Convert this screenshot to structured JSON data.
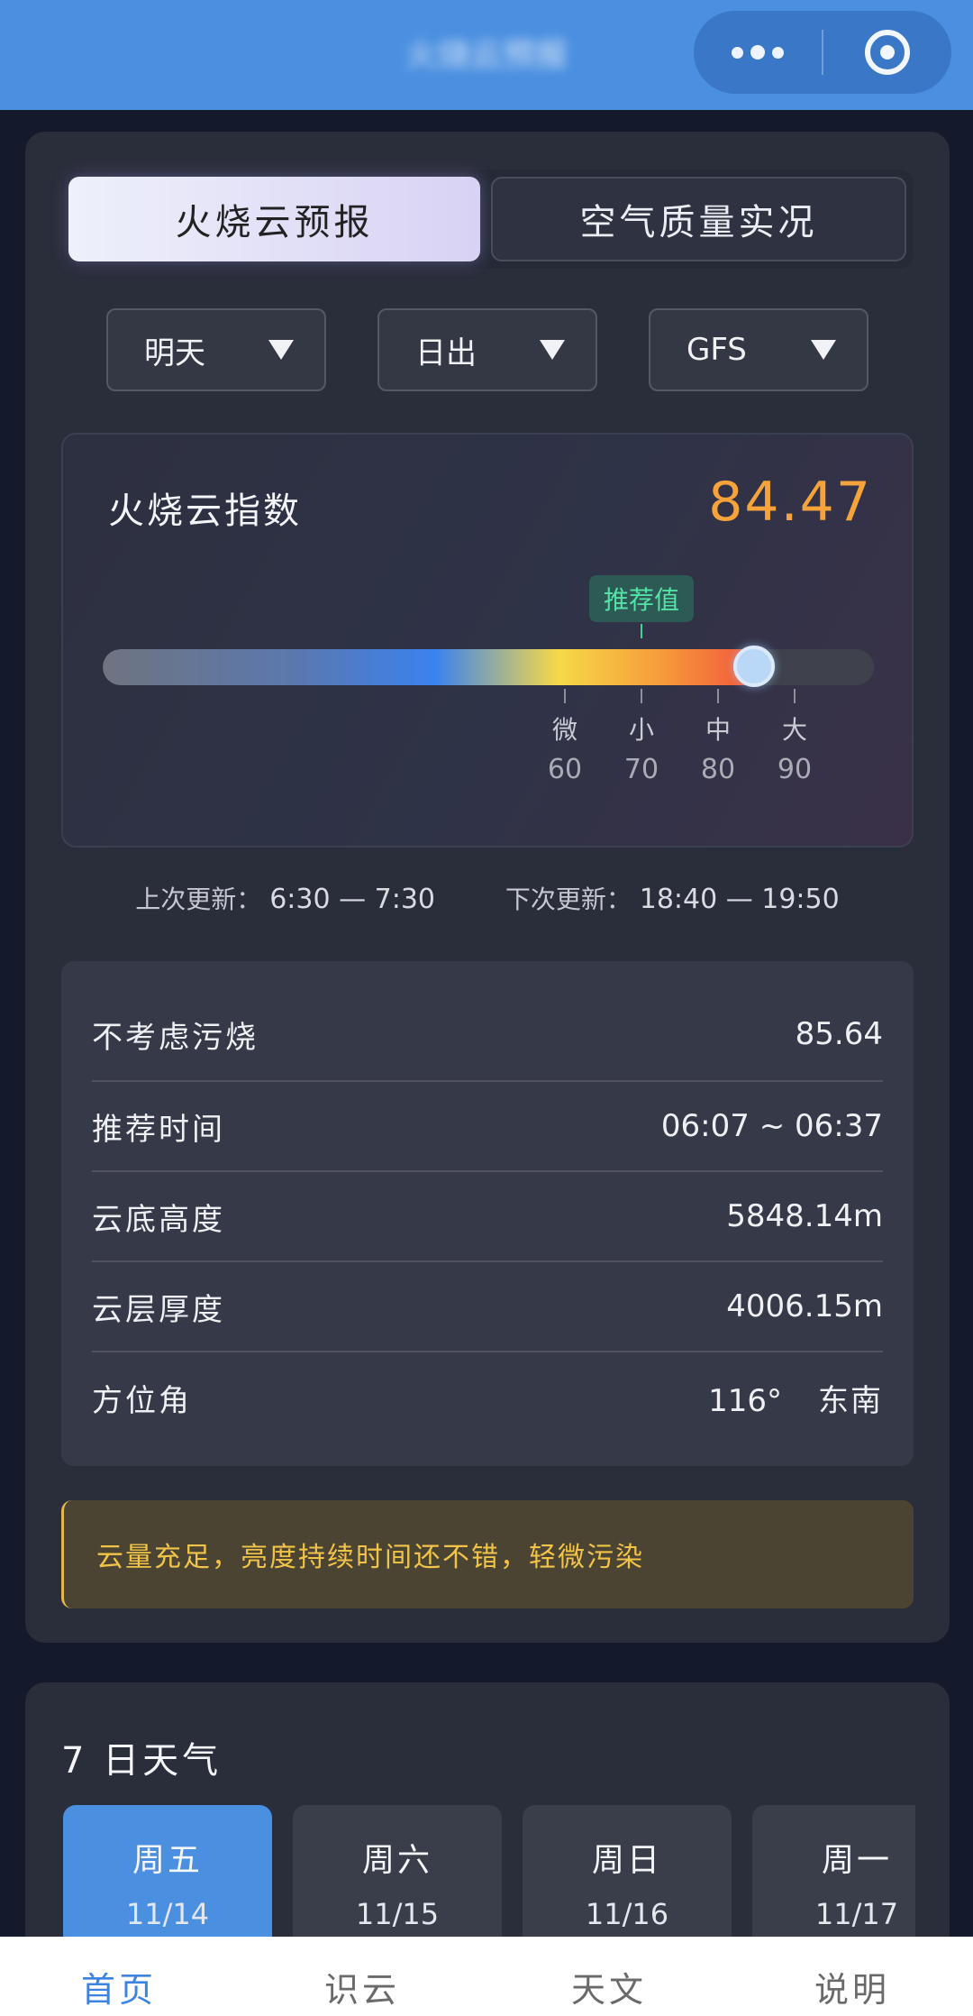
{
  "header": {
    "title": "火烧云预报"
  },
  "tabs": [
    {
      "label": "火烧云预报",
      "active": true
    },
    {
      "label": "空气质量实况",
      "active": false
    }
  ],
  "selects": {
    "day": "明天",
    "event": "日出",
    "model": "GFS"
  },
  "index": {
    "label": "火烧云指数",
    "value": "84.47",
    "progress": 84.47,
    "recommend_label": "推荐值",
    "ticks": [
      {
        "name": "微",
        "value": "60"
      },
      {
        "name": "小",
        "value": "70"
      },
      {
        "name": "中",
        "value": "80"
      },
      {
        "name": "大",
        "value": "90"
      }
    ]
  },
  "update": {
    "last_label": "上次更新：",
    "last_time": "6:30 — 7:30",
    "next_label": "下次更新：",
    "next_time": "18:40 — 19:50"
  },
  "details": [
    {
      "key": "不考虑污烧",
      "value": "85.64"
    },
    {
      "key": "推荐时间",
      "value": "06:07 ~ 06:37"
    },
    {
      "key": "云底高度",
      "value": "5848.14m"
    },
    {
      "key": "云层厚度",
      "value": "4006.15m"
    },
    {
      "key": "方位角",
      "value": "116°",
      "direction": "东南"
    }
  ],
  "tip": "云量充足，亮度持续时间还不错，轻微污染",
  "weather": {
    "title": "7 日天气",
    "days": [
      {
        "name": "周五",
        "date": "11/14",
        "active": true
      },
      {
        "name": "周六",
        "date": "11/15",
        "active": false
      },
      {
        "name": "周日",
        "date": "11/16",
        "active": false
      },
      {
        "name": "周一",
        "date": "11/17",
        "active": false
      }
    ]
  },
  "nav": [
    {
      "label": "首页",
      "active": true
    },
    {
      "label": "识云",
      "active": false
    },
    {
      "label": "天文",
      "active": false
    },
    {
      "label": "说明",
      "active": false
    }
  ],
  "colors": {
    "accent": "#4a8fe0",
    "index_value": "#f5a33a",
    "recommend": "#53e3a6",
    "tip_text": "#f1c448"
  }
}
